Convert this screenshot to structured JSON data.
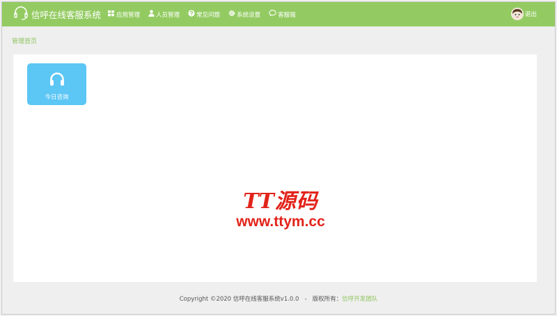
{
  "header": {
    "brand_title": "信呼在线客服系统",
    "nav": [
      {
        "label": "应用管理",
        "icon": "grid-icon"
      },
      {
        "label": "人员管理",
        "icon": "user-icon"
      },
      {
        "label": "常见问题",
        "icon": "question-icon"
      },
      {
        "label": "系统设置",
        "icon": "gear-icon"
      },
      {
        "label": "客服端",
        "icon": "chat-icon"
      }
    ],
    "user_action": "退出"
  },
  "breadcrumb": "管理首页",
  "tiles": [
    {
      "label": "今日咨询",
      "icon": "headset-icon"
    }
  ],
  "watermark": {
    "title": "TT源码",
    "url": "www.ttym.cc"
  },
  "footer": {
    "copyright": "Copyright ©2020 信呼在线客服系统v1.0.0",
    "separator": "-",
    "rights_label": "版权所有：",
    "team": "信呼开发团队"
  },
  "colors": {
    "topbar": "#93cb62",
    "accent_text": "#8fc460",
    "tile": "#5cc6f5",
    "watermark": "#e2231a"
  }
}
